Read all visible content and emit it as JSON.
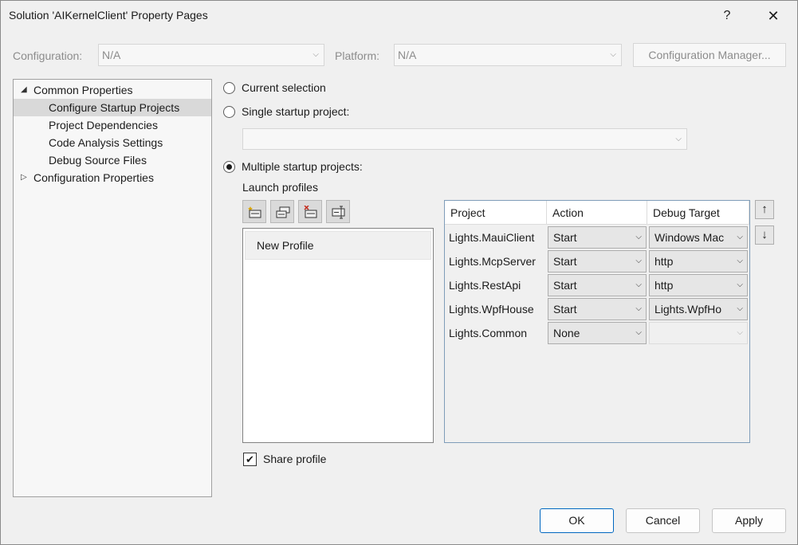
{
  "window": {
    "title": "Solution 'AIKernelClient' Property Pages",
    "help_label": "?",
    "close_label": "✕"
  },
  "config_bar": {
    "configuration_label": "Configuration:",
    "configuration_value": "N/A",
    "platform_label": "Platform:",
    "platform_value": "N/A",
    "config_manager_label": "Configuration Manager..."
  },
  "tree": {
    "items": [
      {
        "label": "Common Properties"
      },
      {
        "label": "Configure Startup Projects"
      },
      {
        "label": "Project Dependencies"
      },
      {
        "label": "Code Analysis Settings"
      },
      {
        "label": "Debug Source Files"
      },
      {
        "label": "Configuration Properties"
      }
    ]
  },
  "startup": {
    "current_selection_label": "Current selection",
    "single_startup_label": "Single startup project:",
    "single_startup_value": "",
    "multiple_startup_label": "Multiple startup projects:",
    "selected_option": "multiple"
  },
  "launch_profiles": {
    "label": "Launch profiles",
    "toolbar": [
      "new-profile-icon",
      "copy-profile-icon",
      "delete-profile-icon",
      "rename-profile-icon"
    ],
    "items": [
      "New Profile"
    ],
    "share_profile_label": "Share profile",
    "share_profile_checked": true
  },
  "grid": {
    "headers": {
      "project": "Project",
      "action": "Action",
      "debug_target": "Debug Target"
    },
    "rows": [
      {
        "project": "Lights.MauiClient",
        "action": "Start",
        "debug_target": "Windows Mac"
      },
      {
        "project": "Lights.McpServer",
        "action": "Start",
        "debug_target": "http"
      },
      {
        "project": "Lights.RestApi",
        "action": "Start",
        "debug_target": "http"
      },
      {
        "project": "Lights.WpfHouse",
        "action": "Start",
        "debug_target": "Lights.WpfHo"
      },
      {
        "project": "Lights.Common",
        "action": "None",
        "debug_target": ""
      }
    ],
    "move_up_label": "↑",
    "move_down_label": "↓"
  },
  "footer": {
    "ok_label": "OK",
    "cancel_label": "Cancel",
    "apply_label": "Apply"
  },
  "colors": {
    "background": "#f0f0f0",
    "selection": "#d9d9d9",
    "default_button_border": "#0067c0",
    "grid_border": "#7f9db9"
  }
}
